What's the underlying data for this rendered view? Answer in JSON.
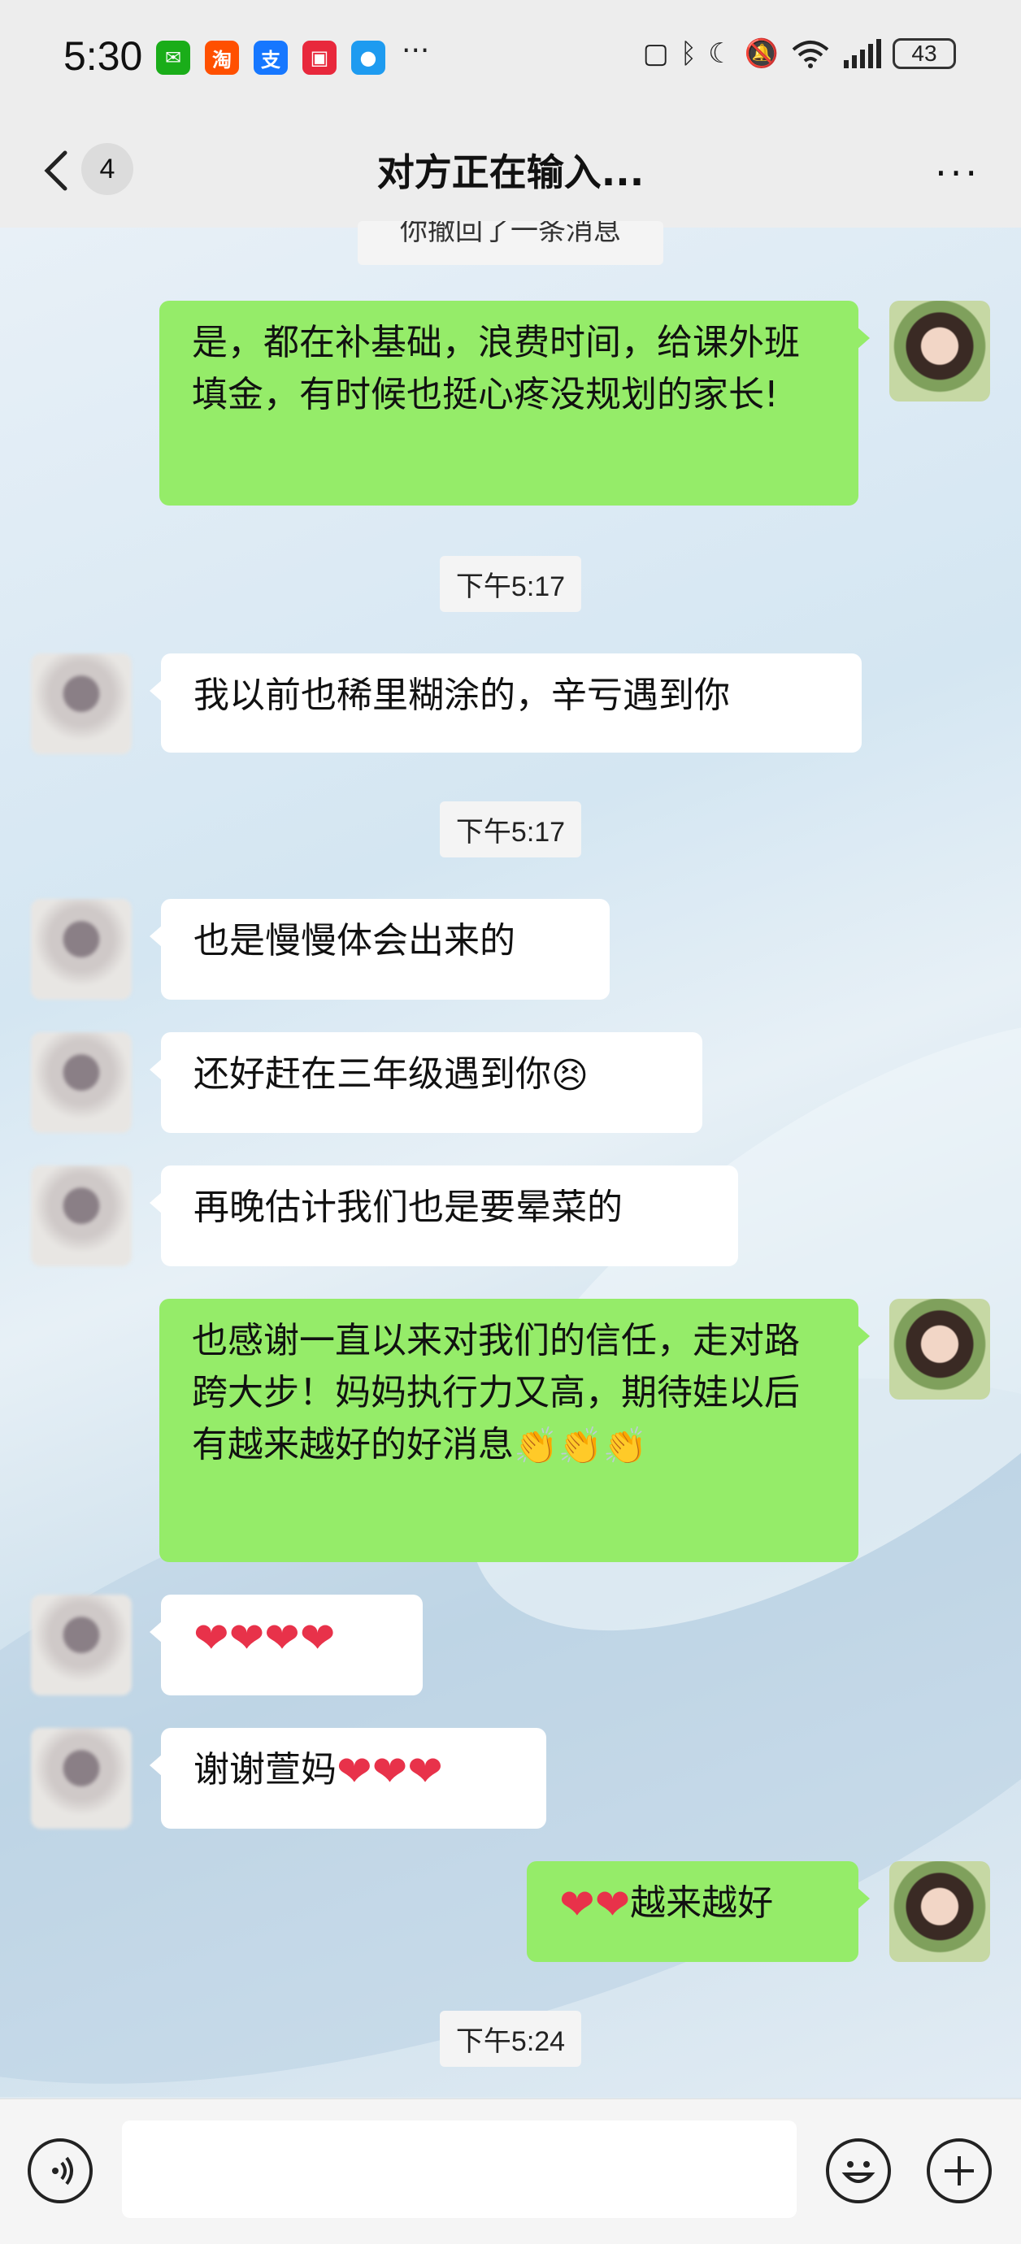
{
  "status_bar": {
    "time": "5:30",
    "battery": "43",
    "apps": [
      {
        "icon": "wechat-icon",
        "color": "#1aad19",
        "glyph": "✉"
      },
      {
        "icon": "taobao-icon",
        "color": "#ff5000",
        "glyph": "淘"
      },
      {
        "icon": "alipay-icon",
        "color": "#1677ff",
        "glyph": "支"
      },
      {
        "icon": "huawei-store-icon",
        "color": "#e8283c",
        "glyph": "▣"
      },
      {
        "icon": "message-icon",
        "color": "#1e9bf0",
        "glyph": "●"
      }
    ],
    "more_glyph": "···"
  },
  "header": {
    "unread_count": "4",
    "title": "对方正在输入...",
    "more_glyph": "···"
  },
  "recall_notice": "你撤回了一条消息",
  "messages": [
    {
      "id": "m1",
      "side": "out",
      "text": "是，都在补基础，浪费时间，给课外班填金，有时候也挺心疼没规划的家长!"
    },
    {
      "id": "t1",
      "type": "time",
      "text": "下午5:17"
    },
    {
      "id": "m2",
      "side": "in",
      "text": "我以前也稀里糊涂的，辛亏遇到你"
    },
    {
      "id": "t2",
      "type": "time",
      "text": "下午5:17"
    },
    {
      "id": "m3",
      "side": "in",
      "text": "也是慢慢体会出来的"
    },
    {
      "id": "m4",
      "side": "in",
      "text": "还好赶在三年级遇到你",
      "emoji": "😣"
    },
    {
      "id": "m5",
      "side": "in",
      "text": "再晚估计我们也是要晕菜的"
    },
    {
      "id": "m6",
      "side": "out",
      "text": "也感谢一直以来对我们的信任，走对路跨大步！妈妈执行力又高，期待娃以后有越来越好的好消息",
      "emoji": "👏👏👏"
    },
    {
      "id": "m7",
      "side": "in",
      "text": "",
      "emoji": "❤❤❤❤"
    },
    {
      "id": "m8",
      "side": "in",
      "text": "谢谢萱妈",
      "emoji": "❤❤❤"
    },
    {
      "id": "m9",
      "side": "out",
      "text": "越来越好",
      "emoji_prefix": "❤❤"
    },
    {
      "id": "t3",
      "type": "time",
      "text": "下午5:24"
    }
  ],
  "colors": {
    "outgoing_bubble": "#95ec69",
    "incoming_bubble": "#ffffff",
    "heart": "#e8324a"
  }
}
